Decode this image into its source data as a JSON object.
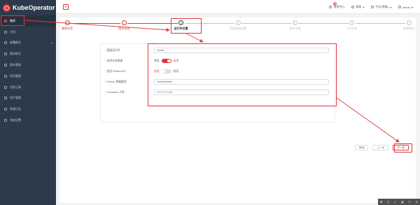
{
  "app": {
    "name": "KubeOperator"
  },
  "sidebar": {
    "items": [
      {
        "label": "集群",
        "icon": "cluster-icon",
        "active": true
      },
      {
        "label": "主机",
        "icon": "host-icon"
      },
      {
        "label": "部署模式",
        "icon": "deploy-icon",
        "has_caret": true
      },
      {
        "label": "备份账号",
        "icon": "backup-icon"
      },
      {
        "label": "版本管理",
        "icon": "version-icon"
      },
      {
        "label": "项目管理",
        "icon": "project-icon"
      },
      {
        "label": "消息订阅",
        "icon": "message-icon"
      },
      {
        "label": "用户管理",
        "icon": "user-icon"
      },
      {
        "label": "系统日志",
        "icon": "log-icon"
      },
      {
        "label": "系统设置",
        "icon": "settings-icon"
      }
    ]
  },
  "header": {
    "menu_icon": "☰",
    "messages_label": "消息中心",
    "messages_badge": "9",
    "help_label": "帮助",
    "language_label": "中文(简体)",
    "user_label": "admin"
  },
  "steps": [
    {
      "num": "✓",
      "label": "集群信息",
      "state": "done"
    },
    {
      "num": "✓",
      "label": "版本设置",
      "state": "done"
    },
    {
      "num": "3",
      "label": "运行时设置",
      "state": "current"
    },
    {
      "num": "4",
      "label": "容器网络设置",
      "state": "todo"
    },
    {
      "num": "5",
      "label": "组件设置",
      "state": "todo"
    },
    {
      "num": "6",
      "label": "节点信息",
      "state": "todo"
    },
    {
      "num": "7",
      "label": "配置概览",
      "state": "todo"
    }
  ],
  "form": {
    "runtime": {
      "label": "容器运行时",
      "value": "docker"
    },
    "remote_registry": {
      "label": "启用仓库镜像",
      "left": "禁用",
      "right": "启用",
      "on": true
    },
    "restful_api": {
      "label": "启用 Restful API",
      "left": "启用",
      "right": "禁用",
      "on": false
    },
    "data_path": {
      "label": "Docker 数据路径",
      "value": "/var/lib/docker"
    },
    "subnet": {
      "label": "Container 子网",
      "value": "172.17.0.1/16"
    }
  },
  "buttons": {
    "cancel": "取消",
    "prev": "上一步",
    "next": "下一步"
  },
  "toolbar": {
    "items": [
      "⧉",
      "◫",
      "⤢",
      "▦",
      "✎",
      "⊕"
    ]
  },
  "colors": {
    "accent": "#e0383e",
    "sidebar": "#2d3a4b"
  }
}
